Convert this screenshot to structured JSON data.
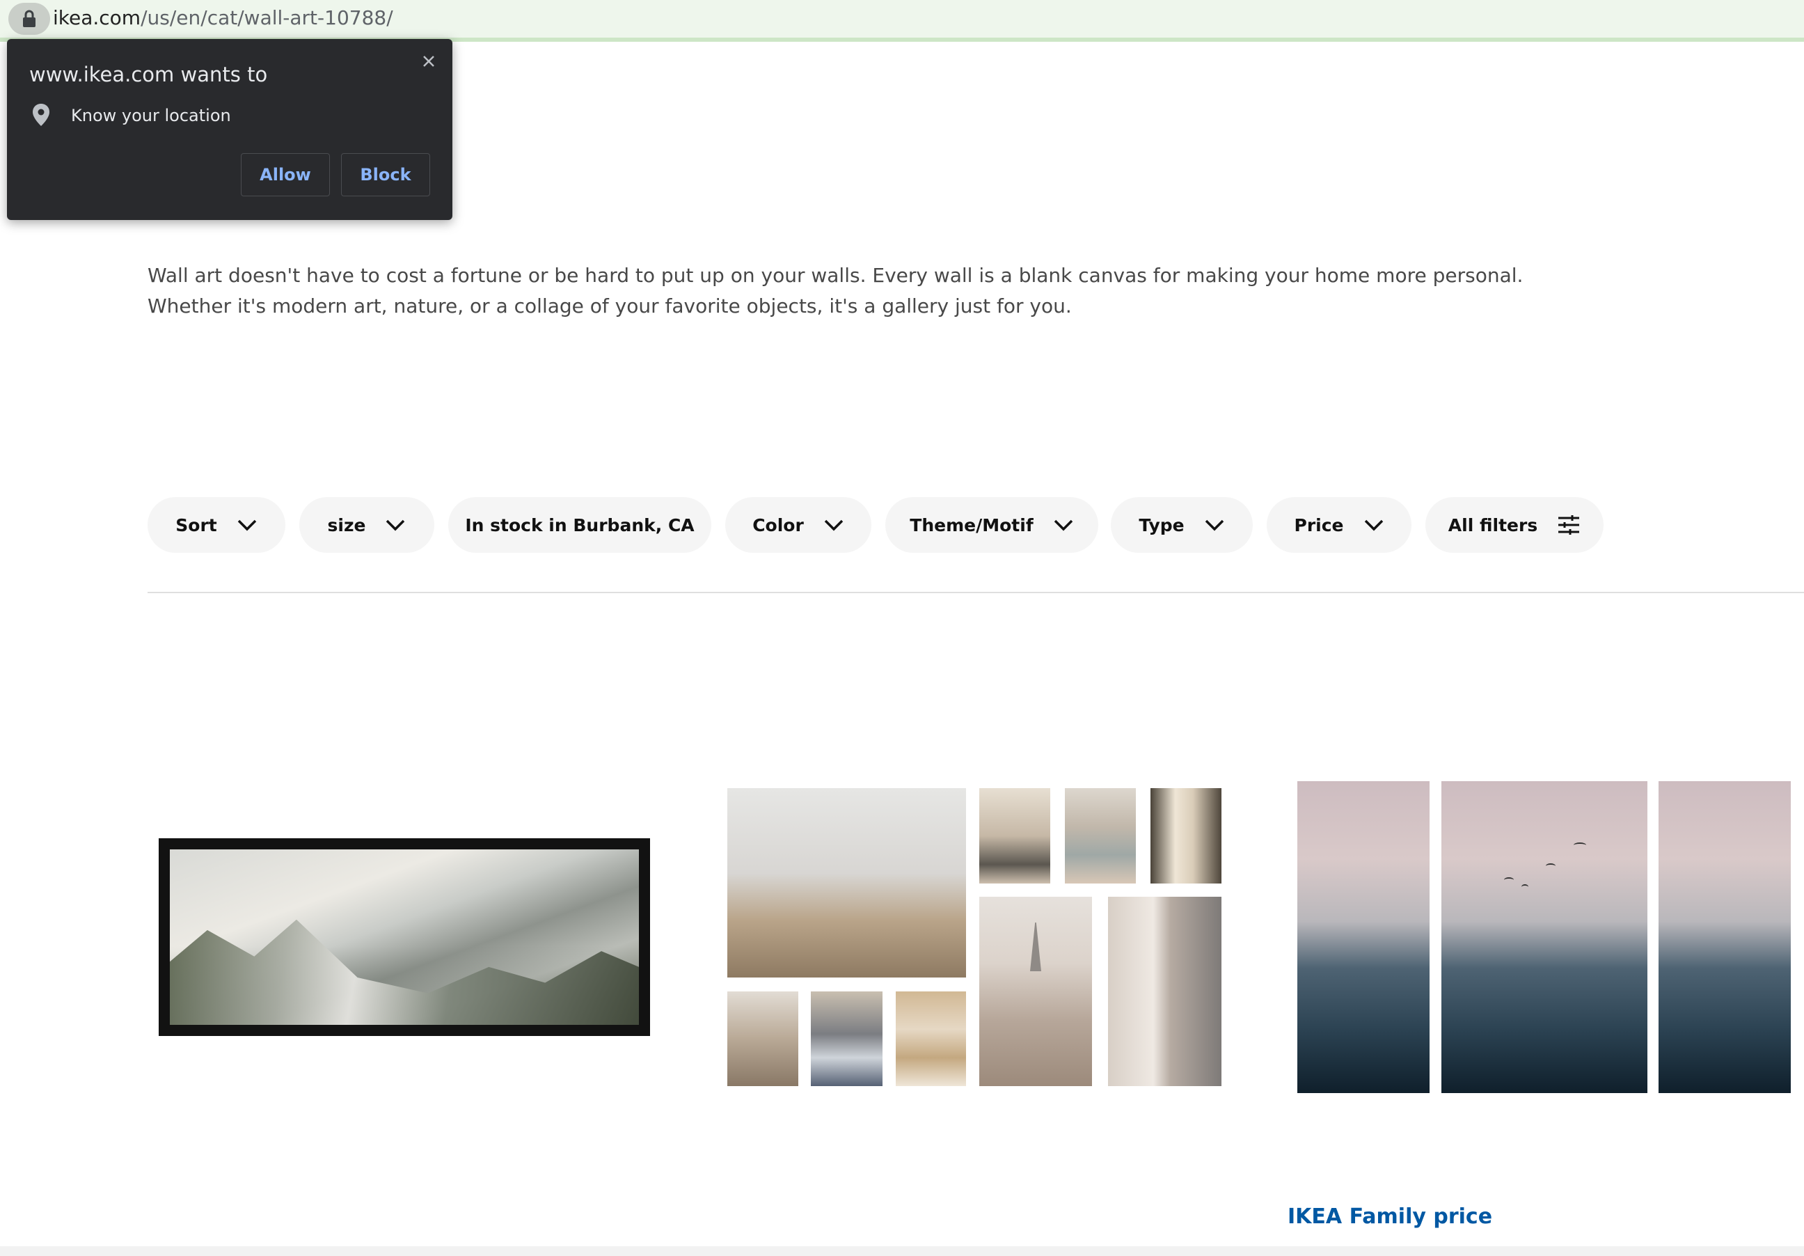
{
  "browser": {
    "url_domain": "ikea.com",
    "url_path": "/us/en/cat/wall-art-10788/"
  },
  "permission_prompt": {
    "title": "www.ikea.com wants to",
    "request": "Know your location",
    "allow_label": "Allow",
    "block_label": "Block"
  },
  "page": {
    "description_line1": "Wall art doesn't have to cost a fortune or be hard to put up on your walls. Every wall is a blank canvas for making your home more personal.",
    "description_line2": "Whether it's modern art, nature, or a collage of your favorite objects, it's a gallery just for you."
  },
  "filters": [
    {
      "label": "Sort",
      "icon": "chevron-down-icon"
    },
    {
      "label": "size",
      "icon": "chevron-down-icon"
    },
    {
      "label": "In stock in Burbank, CA",
      "icon": ""
    },
    {
      "label": "Color",
      "icon": "chevron-down-icon"
    },
    {
      "label": "Theme/Motif",
      "icon": "chevron-down-icon"
    },
    {
      "label": "Type",
      "icon": "chevron-down-icon"
    },
    {
      "label": "Price",
      "icon": "chevron-down-icon"
    },
    {
      "label": "All filters",
      "icon": "filter-sliders-icon"
    }
  ],
  "products": {
    "third_price_label": "IKEA Family price"
  },
  "colors": {
    "prompt_bg": "#292a2d",
    "prompt_button_text": "#8ab4f8",
    "pill_bg": "#f5f5f5",
    "family_price": "#0058a3",
    "urlbar_bg": "#eef6ec"
  }
}
